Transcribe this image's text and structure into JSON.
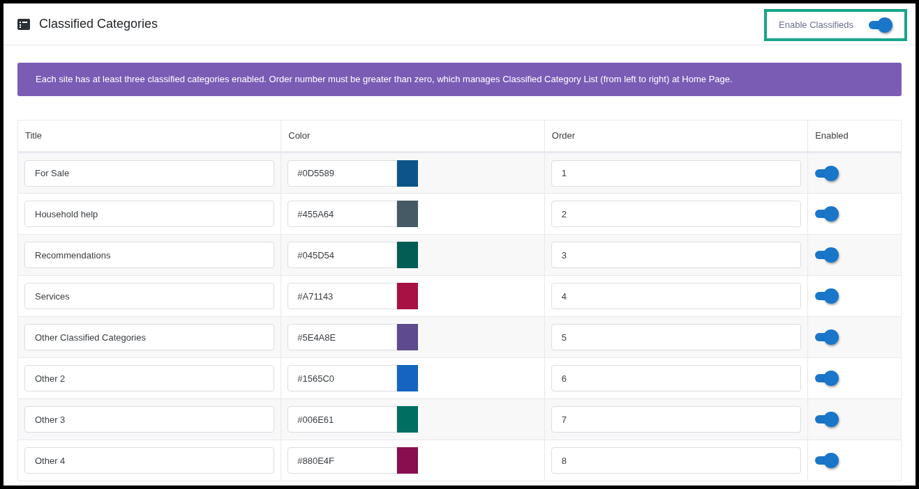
{
  "header": {
    "title": "Classified Categories",
    "enable_toggle": {
      "label": "Enable Classifieds",
      "on": true
    }
  },
  "notice": "Each site has at least three classified categories enabled. Order number must be greater than zero, which manages Classified Category List (from left to right) at Home Page.",
  "table": {
    "columns": [
      "Title",
      "Color",
      "Order",
      "Enabled"
    ],
    "rows": [
      {
        "title": "For Sale",
        "hex": "#0D5589",
        "color": "#0d5589",
        "order": "1",
        "enabled": true
      },
      {
        "title": "Household help",
        "hex": "#455A64",
        "color": "#455a64",
        "order": "2",
        "enabled": true
      },
      {
        "title": "Recommendations",
        "hex": "#045D54",
        "color": "#045d54",
        "order": "3",
        "enabled": true
      },
      {
        "title": "Services",
        "hex": "#A71143",
        "color": "#a71143",
        "order": "4",
        "enabled": true
      },
      {
        "title": "Other Classified Categories",
        "hex": "#5E4A8E",
        "color": "#5e4a8e",
        "order": "5",
        "enabled": true
      },
      {
        "title": "Other 2",
        "hex": "#1565C0",
        "color": "#1565c0",
        "order": "6",
        "enabled": true
      },
      {
        "title": "Other 3",
        "hex": "#006E61",
        "color": "#006e61",
        "order": "7",
        "enabled": true
      },
      {
        "title": "Other 4",
        "hex": "#880E4F",
        "color": "#880e4f",
        "order": "8",
        "enabled": true
      }
    ]
  }
}
